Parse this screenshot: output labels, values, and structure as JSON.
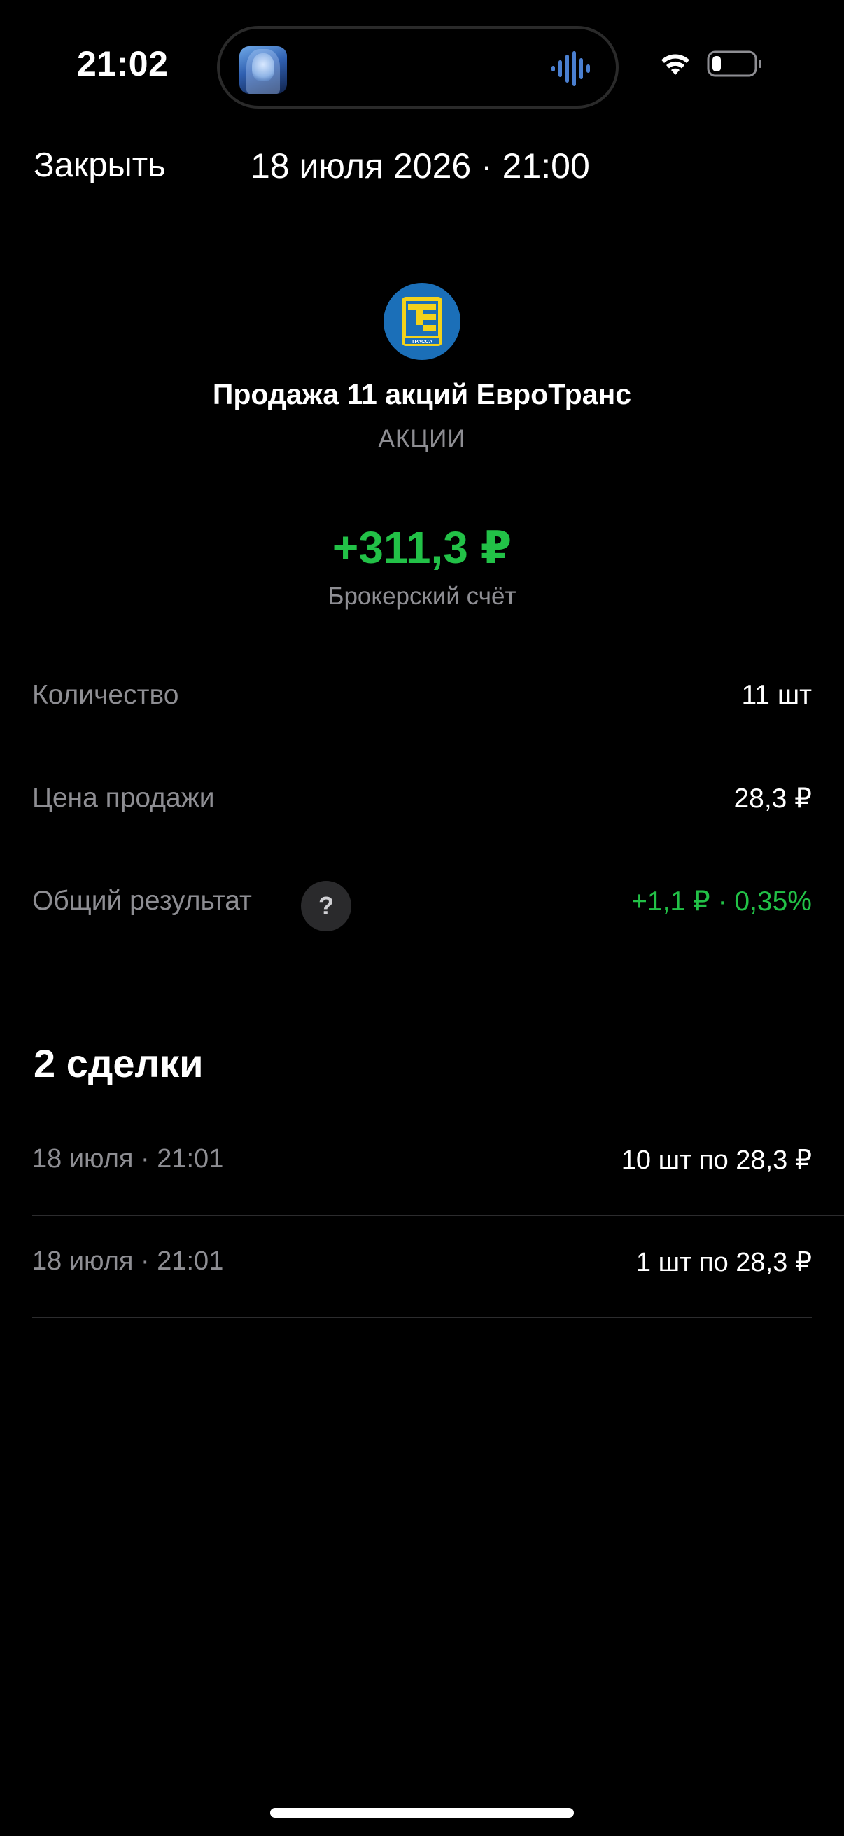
{
  "status_bar": {
    "time": "21:02",
    "now_playing_icon": "album-art-icon",
    "activity_icon": "audio-waveform-icon",
    "wifi_icon": "wifi-icon",
    "battery_icon": "battery-low-icon"
  },
  "nav": {
    "close_label": "Закрыть",
    "datetime": "18 июля 2026 · 21:00"
  },
  "operation": {
    "logo_icon": "trassa-logo-icon",
    "title": "Продажа 11 акций ЕвроТранс",
    "type": "АКЦИИ",
    "amount": "+311,3 ₽",
    "account": "Брокерский счёт"
  },
  "details": [
    {
      "label": "Количество",
      "value": "11 шт"
    },
    {
      "label": "Цена продажи",
      "value": "28,3 ₽"
    },
    {
      "label": "Общий результат",
      "value": "+1,1 ₽ · 0,35%",
      "help": "?"
    }
  ],
  "deals": {
    "title": "2 сделки",
    "items": [
      {
        "date": "18 июля · 21:01",
        "qty": "10 шт по 28,3 ₽"
      },
      {
        "date": "18 июля · 21:01",
        "qty": "1 шт по 28,3 ₽"
      }
    ]
  },
  "colors": {
    "positive": "#22c147",
    "muted": "#8e8e93",
    "background": "#000000"
  }
}
